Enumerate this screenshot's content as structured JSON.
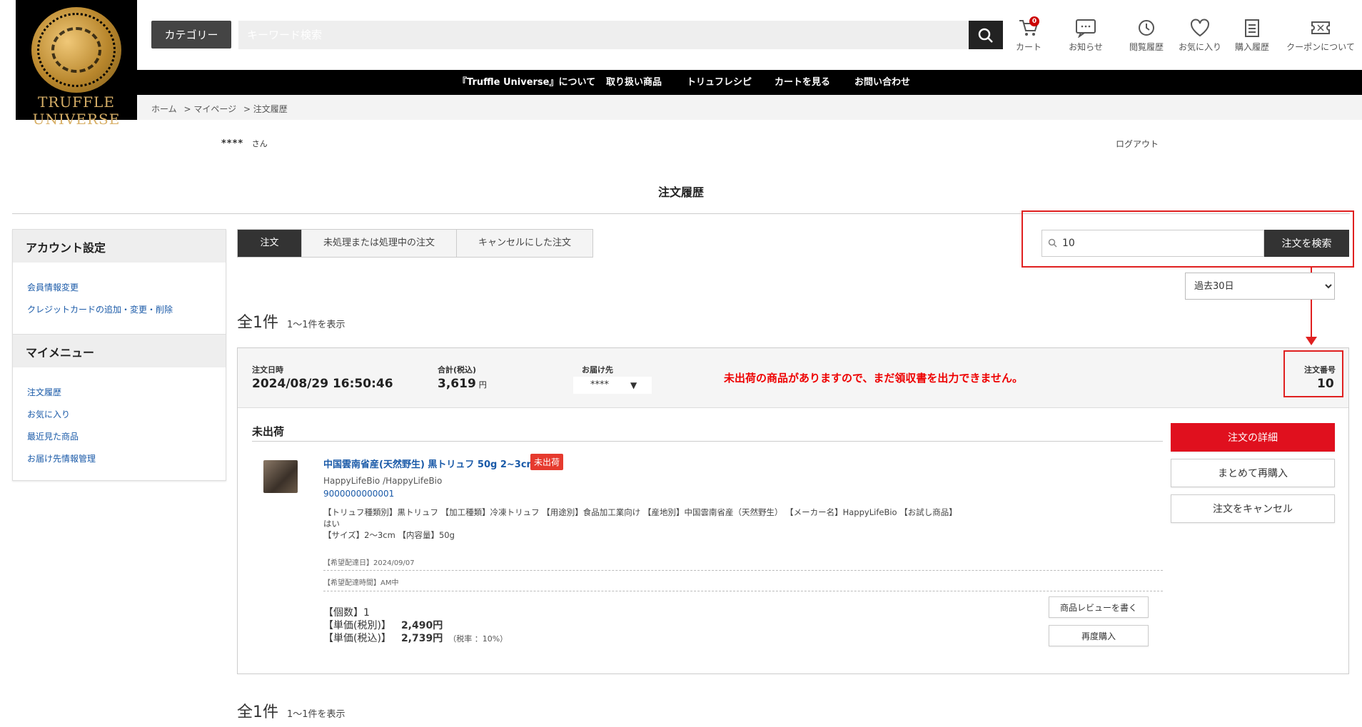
{
  "header": {
    "logo_text_line1": "TRUFFLE",
    "logo_text_line2": "UNIVERSE",
    "category_label": "カテゴリー",
    "search_placeholder": "キーワード検索",
    "cart_count": "0",
    "icons": [
      {
        "label": "カート",
        "icon": "cart-icon"
      },
      {
        "label": "お知らせ",
        "icon": "chat-icon"
      },
      {
        "label": "閲覧履歴",
        "icon": "history-icon"
      },
      {
        "label": "お気に入り",
        "icon": "heart-icon"
      },
      {
        "label": "購入履歴",
        "icon": "clipboard-icon"
      },
      {
        "label": "クーポンについて",
        "icon": "coupon-icon"
      }
    ]
  },
  "nav": {
    "items": [
      "『Truffle Universe』について",
      "取り扱い商品",
      "トリュフレシピ",
      "カートを見る",
      "お問い合わせ"
    ]
  },
  "breadcrumb": [
    "ホーム",
    "> マイページ",
    "> 注文履歴"
  ],
  "user": {
    "name": "****",
    "suffix": "さん",
    "logout": "ログアウト"
  },
  "page_title": "注文履歴",
  "sidebar": {
    "account_title": "アカウント設定",
    "account_links": [
      "会員情報変更",
      "クレジットカードの追加・変更・削除"
    ],
    "menu_title": "マイメニュー",
    "menu_links": [
      "注文履歴",
      "お気に入り",
      "最近見た商品",
      "お届け先情報管理"
    ]
  },
  "tabs": [
    "注文",
    "未処理または処理中の注文",
    "キャンセルにした注文"
  ],
  "order_search": {
    "value": "10",
    "button": "注文を検索"
  },
  "period": {
    "selected": "過去30日"
  },
  "count": {
    "total": "全1件",
    "range": "1～1件を表示"
  },
  "order": {
    "date_label": "注文日時",
    "date": "2024/08/29 16:50:46",
    "total_label": "合計(税込)",
    "total": "3,619",
    "total_unit": "円",
    "delivery_label": "お届け先",
    "delivery": "****",
    "notice": "未出荷の商品がありますので、まだ領収書を出力できません。",
    "number_label": "注文番号",
    "number": "10",
    "status": "未出荷",
    "product_name": "中国雲南省産(天然野生) 黒トリュフ 50g 2~3cm",
    "product_tag": "未出荷",
    "maker": "HappyLifeBio /HappyLifeBio",
    "code": "9000000000001",
    "spec_line1": "【トリュフ種類別】黒トリュフ 【加工種類】冷凍トリュフ 【用途別】食品加工業向け 【産地別】中国雲南省産（天然野生） 【メーカー名】HappyLifeBio 【お試し商品】",
    "spec_line2": "はい",
    "spec_line3": "【サイズ】2～3cm 【内容量】50g",
    "delivery_date": "【希望配達日】2024/09/07",
    "delivery_time": "【希望配達時間】AM中",
    "qty_label": "【個数】",
    "qty": "1",
    "price_ex_label": "【単価(税別)】",
    "price_ex": "2,490円",
    "price_in_label": "【単価(税込)】",
    "price_in": "2,739円",
    "tax_rate": "（税率 ：10%）",
    "review_btn": "商品レビューを書く",
    "rebuy_btn": "再度購入",
    "detail_btn": "注文の詳細",
    "bulk_rebuy_btn": "まとめて再購入",
    "cancel_btn": "注文をキャンセル"
  },
  "colors": {
    "accent_red": "#e0101e",
    "link_blue": "#1a5aa8",
    "annotation_red": "#e02020"
  }
}
